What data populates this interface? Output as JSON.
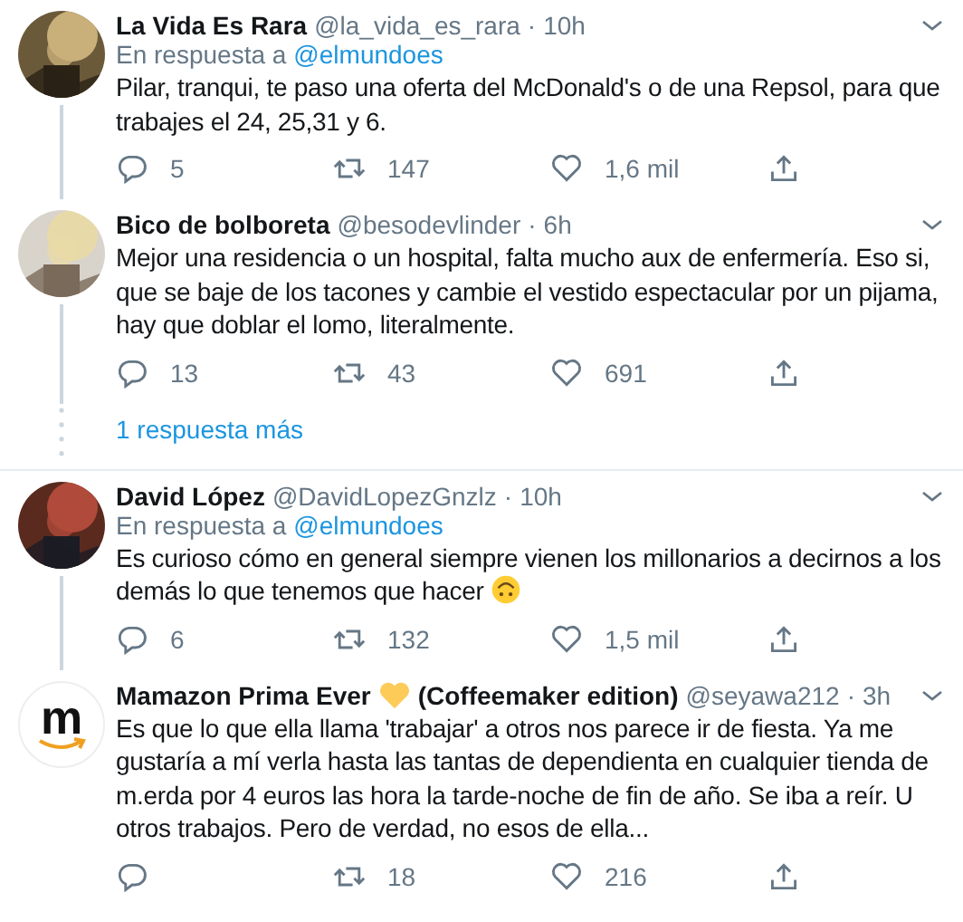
{
  "groups": [
    {
      "tweets": [
        {
          "name": "La Vida Es Rara",
          "handle": "@la_vida_es_rara",
          "separator": "·",
          "time": "10h",
          "reply_prefix": "En respuesta a",
          "reply_to": "@elmundoes",
          "text": "Pilar, tranqui, te paso una oferta del McDonald's o de una Repsol, para que trabajes el 24, 25,31 y 6.",
          "replies": "5",
          "retweets": "147",
          "likes": "1,6 mil",
          "thread_below": true
        },
        {
          "name": "Bico de bolboreta",
          "handle": "@besodevlinder",
          "separator": "·",
          "time": "6h",
          "text": "Mejor una residencia o un hospital, falta mucho aux de enfermería. Eso si, que se baje de los tacones y cambie el vestido espectacular por un pijama, hay que doblar el lomo, literalmente.",
          "replies": "13",
          "retweets": "43",
          "likes": "691",
          "thread_below": true
        }
      ],
      "more_replies": "1 respuesta más"
    },
    {
      "tweets": [
        {
          "name": "David López",
          "handle": "@DavidLopezGnzlz",
          "separator": "·",
          "time": "10h",
          "reply_prefix": "En respuesta a",
          "reply_to": "@elmundoes",
          "text": "Es curioso cómo en general siempre vienen los millonarios a decirnos a los demás lo que tenemos que hacer",
          "ends_with_emoji": true,
          "replies": "6",
          "retweets": "132",
          "likes": "1,5 mil",
          "thread_below": true
        },
        {
          "name": "Mamazon Prima Ever",
          "heart_after_name": true,
          "name_suffix": "(Coffeemaker edition)",
          "handle": "@seyawa212",
          "separator": "·",
          "time": "3h",
          "avatar": {
            "kind": "logo",
            "letter": "m"
          },
          "text": "Es que lo que ella llama 'trabajar' a otros nos parece ir de fiesta. Ya me gustaría a mí verla hasta las tantas de dependienta en cualquier tienda de m.erda por 4 euros las hora la tarde-noche de fin de año. Se iba a reír. U otros trabajos. Pero de verdad, no esos de ella...",
          "retweets": "18",
          "likes": "216",
          "thread_below": false
        }
      ]
    }
  ]
}
